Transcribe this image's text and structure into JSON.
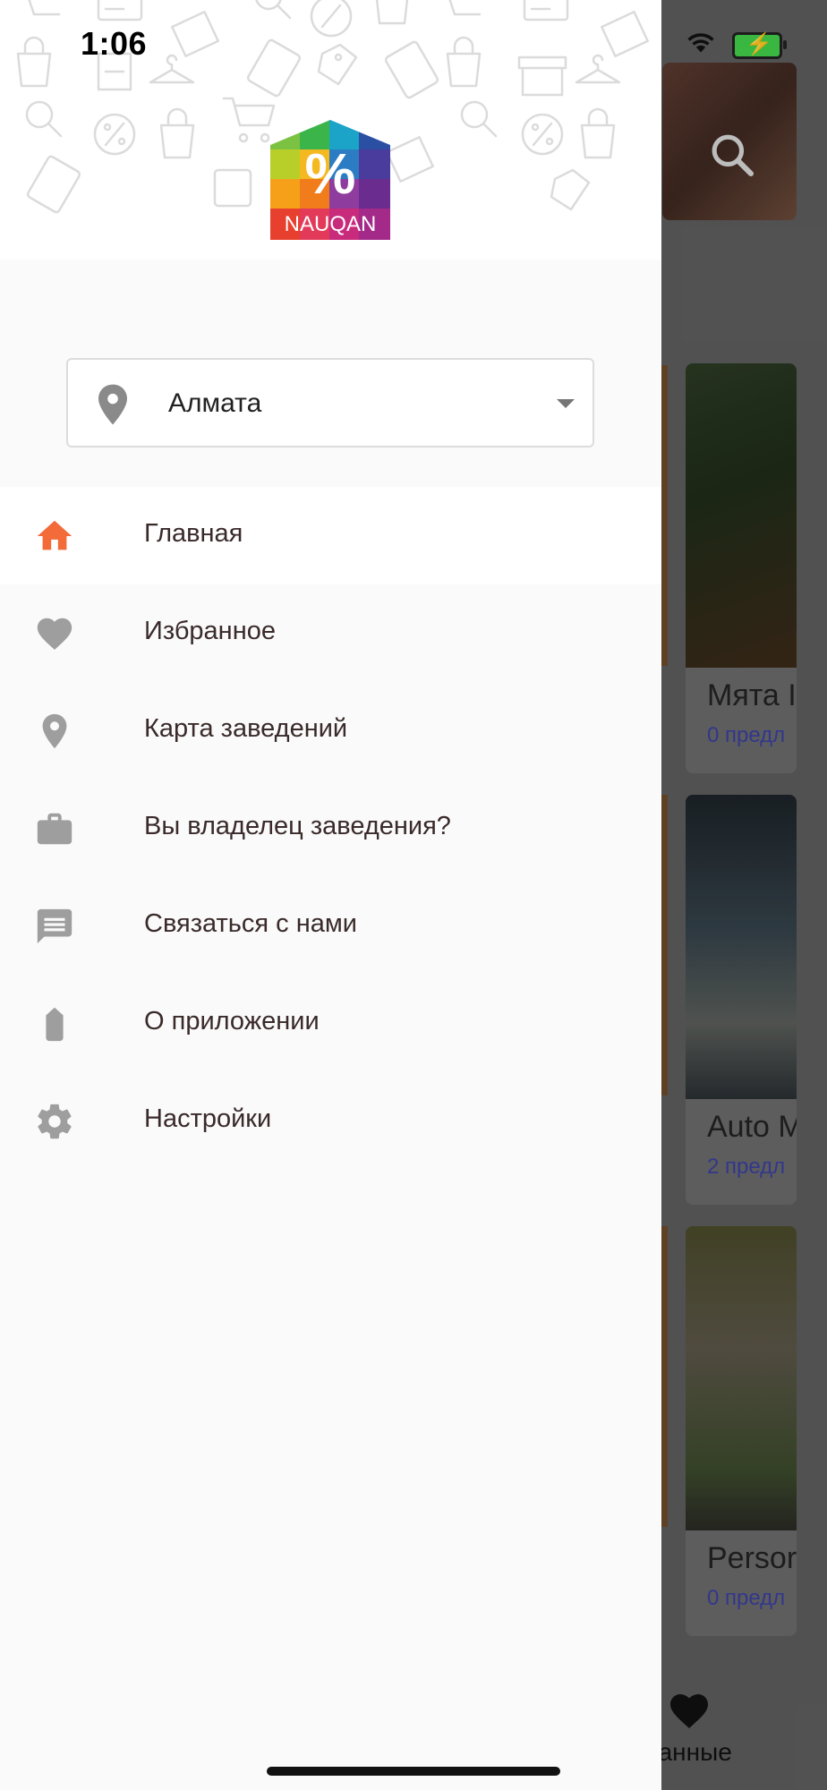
{
  "status_bar": {
    "time": "1:06"
  },
  "app": {
    "logo_text": "NAUQAN",
    "logo_symbol": "%"
  },
  "city_selector": {
    "value": "Алмата",
    "icon": "location-pin-icon"
  },
  "menu": [
    {
      "label": "Главная",
      "icon": "home-icon",
      "active": true
    },
    {
      "label": "Избранное",
      "icon": "heart-icon"
    },
    {
      "label": "Карта заведений",
      "icon": "location-pin-icon"
    },
    {
      "label": "Вы владелец заведения?",
      "icon": "briefcase-icon"
    },
    {
      "label": "Связаться с нами",
      "icon": "chat-icon"
    },
    {
      "label": "О приложении",
      "icon": "tag-icon"
    },
    {
      "label": "Настройки",
      "icon": "gear-icon"
    }
  ],
  "background": {
    "cards": [
      {
        "title": "Мята I",
        "subtitle": "0 предл"
      },
      {
        "title": "Auto M",
        "subtitle": "2 предл"
      },
      {
        "title": "Persor",
        "subtitle": "0 предл"
      }
    ],
    "tab_label": "ранные"
  },
  "colors": {
    "accent": "#f26b38",
    "icon_gray": "#9e9e9e",
    "link_blue": "#3a3fa0"
  }
}
